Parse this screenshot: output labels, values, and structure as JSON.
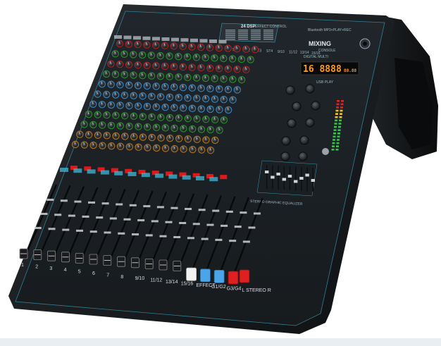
{
  "photo": {
    "subject": "digital mixing console product photo",
    "colors": {
      "background": "#ffffff",
      "body": "#15181b",
      "panel": "#1d2226",
      "accent": "#3fb8d8",
      "lcd": "#ff8c1a",
      "mute_red": "#e01818",
      "fader_white": "#f2f2f2",
      "fader_blue": "#4aa6e8",
      "fader_red": "#e02020"
    }
  },
  "console": {
    "fx_title": "24 DSP",
    "fx_subtitle": "EFFECT CONTROL",
    "player_title": "Bluetooth  MP3+PLAY+REC",
    "brand_line1": "MIXING",
    "brand_line2": "CONSOLE",
    "lcd_value": "16 8888",
    "lcd_small": "88.88",
    "digital_label": "DIGITAL MULTI",
    "usb_label": "USB PLAY",
    "eq_label": "STEREO GRAPHIC EQUALIZER",
    "channel_labels": [
      "1",
      "2",
      "3",
      "4",
      "5",
      "6",
      "7",
      "8",
      "9/10",
      "11/12",
      "13/14",
      "15/16",
      "EFFECT",
      "G1/G2",
      "G3/G4",
      "L STEREO R"
    ],
    "top_labels": [
      "ST1",
      "ST2",
      "ST3",
      "ST4",
      "9/10",
      "11/12",
      "13/14",
      "15/16"
    ]
  }
}
